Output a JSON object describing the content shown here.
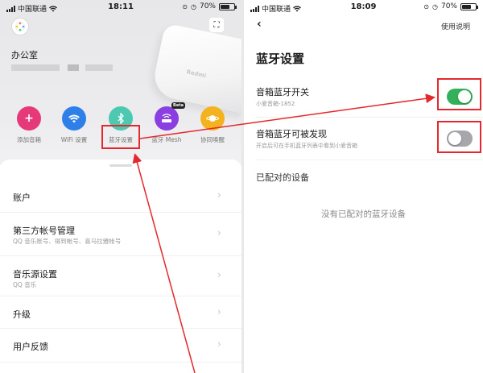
{
  "left": {
    "status": {
      "carrier": "中国联通",
      "time": "18:11",
      "battery": "70%",
      "battery_level": 0.7
    },
    "room_name": "办公室",
    "device_brand": "Redmi",
    "shortcuts": [
      {
        "label": "添加音箱",
        "icon": "plus-icon",
        "color": "#e6397a"
      },
      {
        "label": "WiFi 设置",
        "icon": "wifi-icon",
        "color": "#2f7fe8"
      },
      {
        "label": "蓝牙设置",
        "icon": "bluetooth-icon",
        "color": "#4cc9b0"
      },
      {
        "label": "蓝牙 Mesh",
        "icon": "router-icon",
        "color": "#8b3fe0",
        "badge": "Beta"
      },
      {
        "label": "协同唤醒",
        "icon": "planet-icon",
        "color": "#f3b21e"
      }
    ],
    "menu": [
      {
        "title": "账户",
        "subtitle": ""
      },
      {
        "title": "第三方帐号管理",
        "subtitle": "QQ 音乐账号、得到帐号、喜马拉雅帐号"
      },
      {
        "title": "音乐源设置",
        "subtitle": "QQ 音乐"
      },
      {
        "title": "升级",
        "subtitle": ""
      },
      {
        "title": "用户反馈",
        "subtitle": ""
      }
    ]
  },
  "right": {
    "status": {
      "carrier": "中国联通",
      "time": "18:09",
      "battery": "70%",
      "battery_level": 0.7
    },
    "help_label": "使用说明",
    "title": "蓝牙设置",
    "rows": [
      {
        "title": "音箱蓝牙开关",
        "subtitle": "小爱音箱-1852",
        "on": true
      },
      {
        "title": "音箱蓝牙可被发现",
        "subtitle": "开启后可在手机蓝牙列表中看到小爱音箱",
        "on": false
      }
    ],
    "section_title": "已配对的设备",
    "empty_text": "没有已配对的蓝牙设备"
  },
  "colors": {
    "annotation": "#e5282d",
    "toggle_on": "#33b15a",
    "toggle_off": "#a7a7ab"
  }
}
